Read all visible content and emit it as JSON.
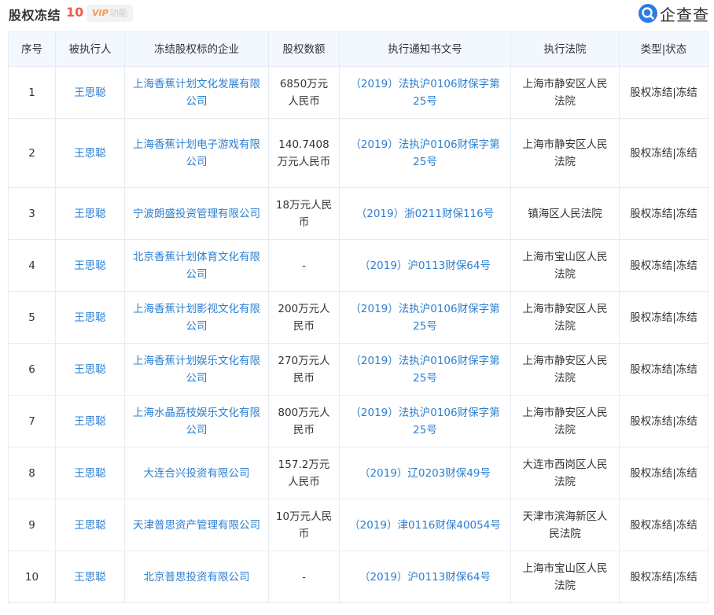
{
  "header": {
    "title": "股权冻结",
    "count": "10",
    "vip_label": "VIP",
    "vip_text": "功能",
    "brand": "企查查",
    "brand_icon": "qichacha-logo-icon"
  },
  "table": {
    "columns": [
      "序号",
      "被执行人",
      "冻结股权标的企业",
      "股权数额",
      "执行通知书文号",
      "执行法院",
      "类型|状态"
    ],
    "rows": [
      {
        "no": "1",
        "person": "王思聪",
        "company": "上海香蕉计划文化发展有限公司",
        "amount": "6850万元人民币",
        "doc": "（2019）法执沪0106财保字第25号",
        "court": "上海市静安区人民法院",
        "status": "股权冻结|冻结"
      },
      {
        "no": "2",
        "person": "王思聪",
        "company": "上海香蕉计划电子游戏有限公司",
        "amount": "140.7408万元人民币",
        "doc": "（2019）法执沪0106财保字第25号",
        "court": "上海市静安区人民法院",
        "status": "股权冻结|冻结"
      },
      {
        "no": "3",
        "person": "王思聪",
        "company": "宁波朗盛投资管理有限公司",
        "amount": "18万元人民币",
        "doc": "（2019）浙0211财保116号",
        "court": "镇海区人民法院",
        "status": "股权冻结|冻结"
      },
      {
        "no": "4",
        "person": "王思聪",
        "company": "北京香蕉计划体育文化有限公司",
        "amount": "-",
        "doc": "（2019）沪0113财保64号",
        "court": "上海市宝山区人民法院",
        "status": "股权冻结|冻结"
      },
      {
        "no": "5",
        "person": "王思聪",
        "company": "上海香蕉计划影视文化有限公司",
        "amount": "200万元人民币",
        "doc": "（2019）法执沪0106财保字第25号",
        "court": "上海市静安区人民法院",
        "status": "股权冻结|冻结"
      },
      {
        "no": "6",
        "person": "王思聪",
        "company": "上海香蕉计划娱乐文化有限公司",
        "amount": "270万元人民币",
        "doc": "（2019）法执沪0106财保字第25号",
        "court": "上海市静安区人民法院",
        "status": "股权冻结|冻结"
      },
      {
        "no": "7",
        "person": "王思聪",
        "company": "上海水晶荔枝娱乐文化有限公司",
        "amount": "800万元人民币",
        "doc": "（2019）法执沪0106财保字第25号",
        "court": "上海市静安区人民法院",
        "status": "股权冻结|冻结"
      },
      {
        "no": "8",
        "person": "王思聪",
        "company": "大连合兴投资有限公司",
        "amount": "157.2万元人民币",
        "doc": "（2019）辽0203财保49号",
        "court": "大连市西岗区人民法院",
        "status": "股权冻结|冻结"
      },
      {
        "no": "9",
        "person": "王思聪",
        "company": "天津普思资产管理有限公司",
        "amount": "10万元人民币",
        "doc": "（2019）津0116财保40054号",
        "court": "天津市滨海新区人民法院",
        "status": "股权冻结|冻结"
      },
      {
        "no": "10",
        "person": "王思聪",
        "company": "北京普思投资有限公司",
        "amount": "-",
        "doc": "（2019）沪0113财保64号",
        "court": "上海市宝山区人民法院",
        "status": "股权冻结|冻结"
      }
    ]
  }
}
